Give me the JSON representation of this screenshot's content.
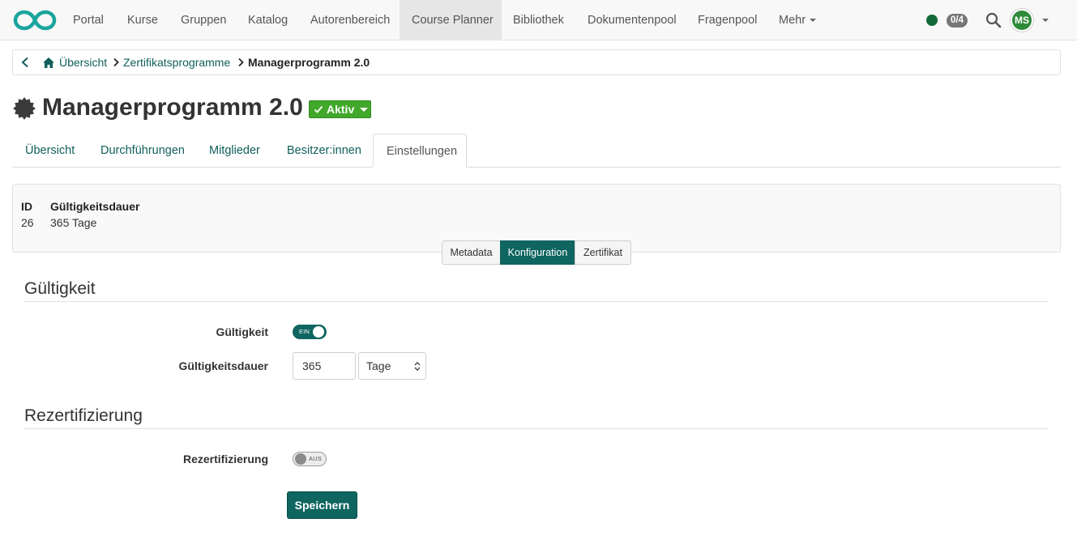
{
  "colors": {
    "brand": "#0f6560",
    "link": "#0f5f5b",
    "status_active": "#42a82b",
    "online_dot": "#12693a",
    "avatar_bg": "#2e8b3a"
  },
  "navbar": {
    "logo": "openolat-infinity-logo",
    "items": [
      {
        "label": "Portal"
      },
      {
        "label": "Kurse"
      },
      {
        "label": "Gruppen"
      },
      {
        "label": "Katalog"
      },
      {
        "label": "Autorenbereich"
      },
      {
        "label": "Course Planner",
        "active": true
      },
      {
        "label": "Bibliothek"
      },
      {
        "label": "Dokumentenpool"
      },
      {
        "label": "Fragenpool"
      },
      {
        "label": "Mehr",
        "dropdown": true
      }
    ],
    "counter": "0/4",
    "icons": [
      "online-status-dot",
      "search-icon",
      "chevron-down-icon"
    ],
    "avatar_initials": "MS"
  },
  "breadcrumb": {
    "items": [
      {
        "label": "Übersicht"
      },
      {
        "label": "Zertifikatsprogramme"
      }
    ],
    "current": "Managerprogramm 2.0"
  },
  "page": {
    "title": "Managerprogramm 2.0",
    "title_icon": "certificate-seal-icon",
    "status_label": "Aktiv"
  },
  "tabs": [
    {
      "label": "Übersicht"
    },
    {
      "label": "Durchführungen"
    },
    {
      "label": "Mitglieder"
    },
    {
      "label": "Besitzer:innen"
    },
    {
      "label": "Einstellungen",
      "active": true
    }
  ],
  "info": {
    "id_header": "ID",
    "id_value": "26",
    "duration_header": "Gültigkeitsdauer",
    "duration_value": "365 Tage"
  },
  "segments": [
    {
      "label": "Metadata"
    },
    {
      "label": "Konfiguration",
      "active": true
    },
    {
      "label": "Zertifikat"
    }
  ],
  "sections": {
    "validity": {
      "title": "Gültigkeit",
      "toggle_label": "Gültigkeit",
      "toggle_state": "EIN",
      "duration_label": "Gültigkeitsdauer",
      "duration_value": "365",
      "unit_value": "Tage"
    },
    "recert": {
      "title": "Rezertifizierung",
      "toggle_label": "Rezertifizierung",
      "toggle_state": "AUS"
    }
  },
  "save_label": "Speichern"
}
